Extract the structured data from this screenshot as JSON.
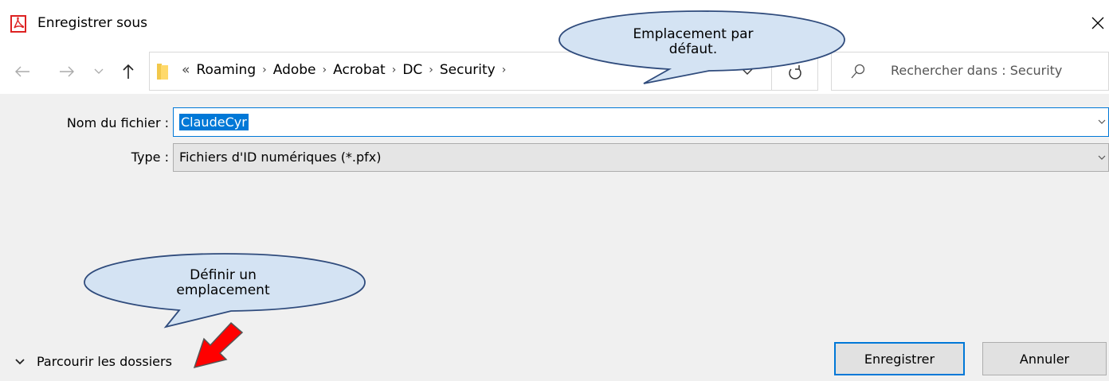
{
  "window": {
    "title": "Enregistrer sous",
    "close_glyph": "✕"
  },
  "nav": {
    "back_glyph": "←",
    "forward_glyph": "→",
    "recent_glyph": "⌄",
    "up_glyph": "↑"
  },
  "address": {
    "overflow": "«",
    "crumbs": [
      "Roaming",
      "Adobe",
      "Acrobat",
      "DC",
      "Security"
    ],
    "separator": "›"
  },
  "search": {
    "placeholder": "Rechercher dans : Security"
  },
  "form": {
    "filename_label": "Nom du fichier :",
    "filename_value": "ClaudeCyr",
    "type_label": "Type :",
    "type_value": "Fichiers d'ID numériques (*.pfx)"
  },
  "footer": {
    "browse_label": "Parcourir les dossiers",
    "save_label": "Enregistrer",
    "cancel_label": "Annuler"
  },
  "callouts": {
    "default_location": [
      "Emplacement par",
      "défaut."
    ],
    "set_location": [
      "Définir un",
      "emplacement"
    ]
  },
  "colors": {
    "accent": "#0078d7",
    "arrow": "#ff0000",
    "callout_fill": "#d4e3f3",
    "callout_stroke": "#2f4b7c"
  }
}
